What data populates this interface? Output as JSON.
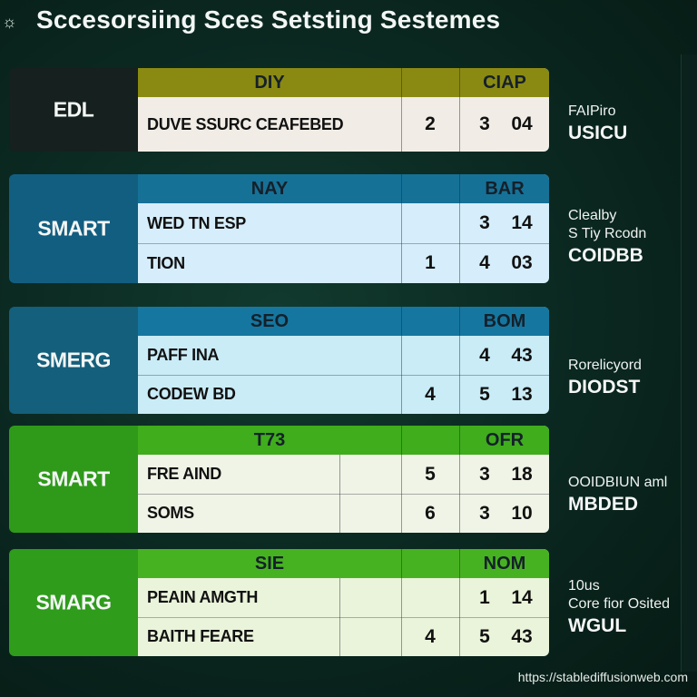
{
  "header": {
    "title": "Sccesorsiing Sces Setsting Sestemes",
    "icon": "eye-logo-icon"
  },
  "groups": [
    {
      "name": "EDL",
      "colors": {
        "left": "#16201e",
        "header": "#8a8a12",
        "body": "#f1ede6"
      },
      "col_headers": [
        "DIY",
        "CIAP"
      ],
      "rows": [
        {
          "label": "DUVE SSURC CEAFEBED",
          "c1": "2",
          "c2": "3",
          "c3": "04"
        }
      ],
      "note": {
        "small": [
          "FAIPiro"
        ],
        "big": "USICU"
      }
    },
    {
      "name": "SMART",
      "colors": {
        "left": "#125e80",
        "header": "#167197",
        "body": "#d6eefb"
      },
      "col_headers": [
        "NAY",
        "BAR"
      ],
      "rows": [
        {
          "label": "WED TN ESP",
          "c1": "",
          "c2": "3",
          "c3": "14"
        },
        {
          "label": "TION",
          "c1": "1",
          "c2": "4",
          "c3": "03"
        }
      ],
      "note": {
        "small": [
          "Clealby",
          "S Tiy Rcodn"
        ],
        "big": "COIDBB"
      }
    },
    {
      "name": "SMERG",
      "colors": {
        "left": "#145f7c",
        "header": "#1577a0",
        "body": "#c9ecf7"
      },
      "col_headers": [
        "SEO",
        "BOM"
      ],
      "rows": [
        {
          "label": "PAFF INA",
          "c1": "",
          "c2": "4",
          "c3": "43"
        },
        {
          "label": "CODEW BD",
          "c1": "4",
          "c2": "5",
          "c3": "13"
        }
      ],
      "note": {
        "small": [
          "Rorelicyord"
        ],
        "big": "DIODST"
      }
    },
    {
      "name": "SMART",
      "colors": {
        "left": "#2f9a1a",
        "header": "#3fad1c",
        "body": "#f0f4e6"
      },
      "col_headers": [
        "T73",
        "OFR"
      ],
      "rows": [
        {
          "label": "FRE AIND",
          "c1": "5",
          "c2": "3",
          "c3": "18"
        },
        {
          "label": "SOMS",
          "c1": "6",
          "c2": "3",
          "c3": "10"
        }
      ],
      "note": {
        "small": [
          "OOIDBIUN aml"
        ],
        "big": "MBDED"
      }
    },
    {
      "name": "SMARG",
      "colors": {
        "left": "#2f9c1c",
        "header": "#47b221",
        "body": "#eaf4da"
      },
      "col_headers": [
        "SIE",
        "NOM"
      ],
      "rows": [
        {
          "label": "PEAIN AMGTH",
          "c1": "",
          "c2": "1",
          "c3": "14"
        },
        {
          "label": "BAITH FEARE",
          "c1": "4",
          "c2": "5",
          "c3": "43"
        }
      ],
      "note": {
        "small": [
          "10us",
          "Core fior Osited"
        ],
        "big": "WGUL"
      }
    }
  ],
  "watermark": "https://stablediffusionweb.com"
}
